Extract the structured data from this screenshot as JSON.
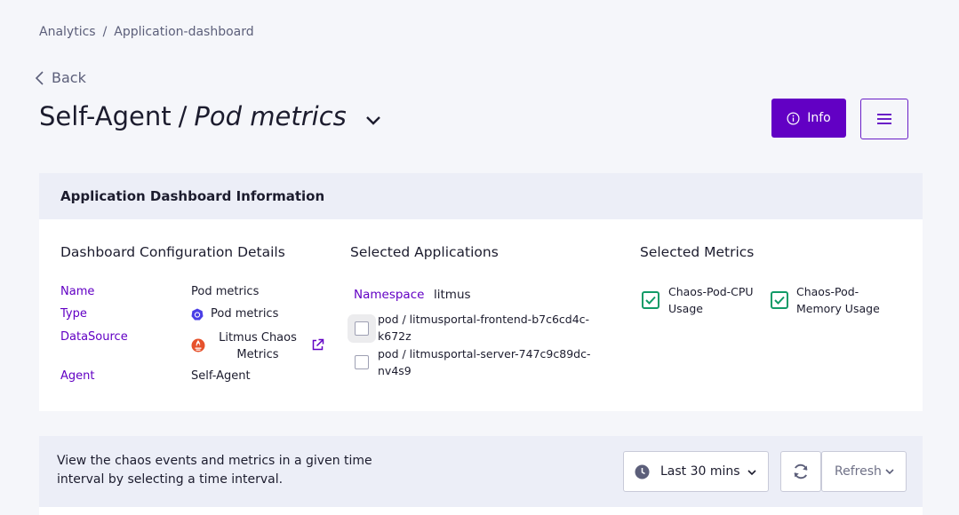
{
  "breadcrumb": {
    "items": [
      "Analytics",
      "Application-dashboard"
    ],
    "separator": "/"
  },
  "back_label": "Back",
  "title": {
    "agent": "Self-Agent",
    "separator": "/",
    "dashboard": "Pod metrics"
  },
  "header_buttons": {
    "info_label": "Info"
  },
  "info_panel": {
    "heading": "Application Dashboard Information",
    "config": {
      "title": "Dashboard Configuration Details",
      "rows": [
        {
          "label": "Name",
          "value": "Pod metrics"
        },
        {
          "label": "Type",
          "value": "Pod metrics"
        },
        {
          "label": "DataSource",
          "value": "Litmus Chaos Metrics"
        },
        {
          "label": "Agent",
          "value": "Self-Agent"
        }
      ]
    },
    "applications": {
      "title": "Selected Applications",
      "namespace_label": "Namespace",
      "namespace_value": "litmus",
      "pods": [
        {
          "line1": "pod / litmusportal-frontend-b7c6cd4c-",
          "line2": "k672z",
          "checked": false
        },
        {
          "line1": "pod / litmusportal-server-747c9c89dc-",
          "line2": "nv4s9",
          "checked": false
        }
      ]
    },
    "metrics": {
      "title": "Selected Metrics",
      "items": [
        {
          "line1": "Chaos-Pod-CPU",
          "line2": "Usage",
          "checked": true
        },
        {
          "line1": "Chaos-Pod-",
          "line2": "Memory Usage",
          "checked": true
        }
      ]
    }
  },
  "time_panel": {
    "description": "View the chaos events and metrics in a given time interval by selecting a time interval.",
    "time_range": "Last 30 mins",
    "refresh_label": "Refresh"
  },
  "colors": {
    "accent": "#6200c4",
    "check_green": "#109b67",
    "header_bg": "#eceef7"
  }
}
